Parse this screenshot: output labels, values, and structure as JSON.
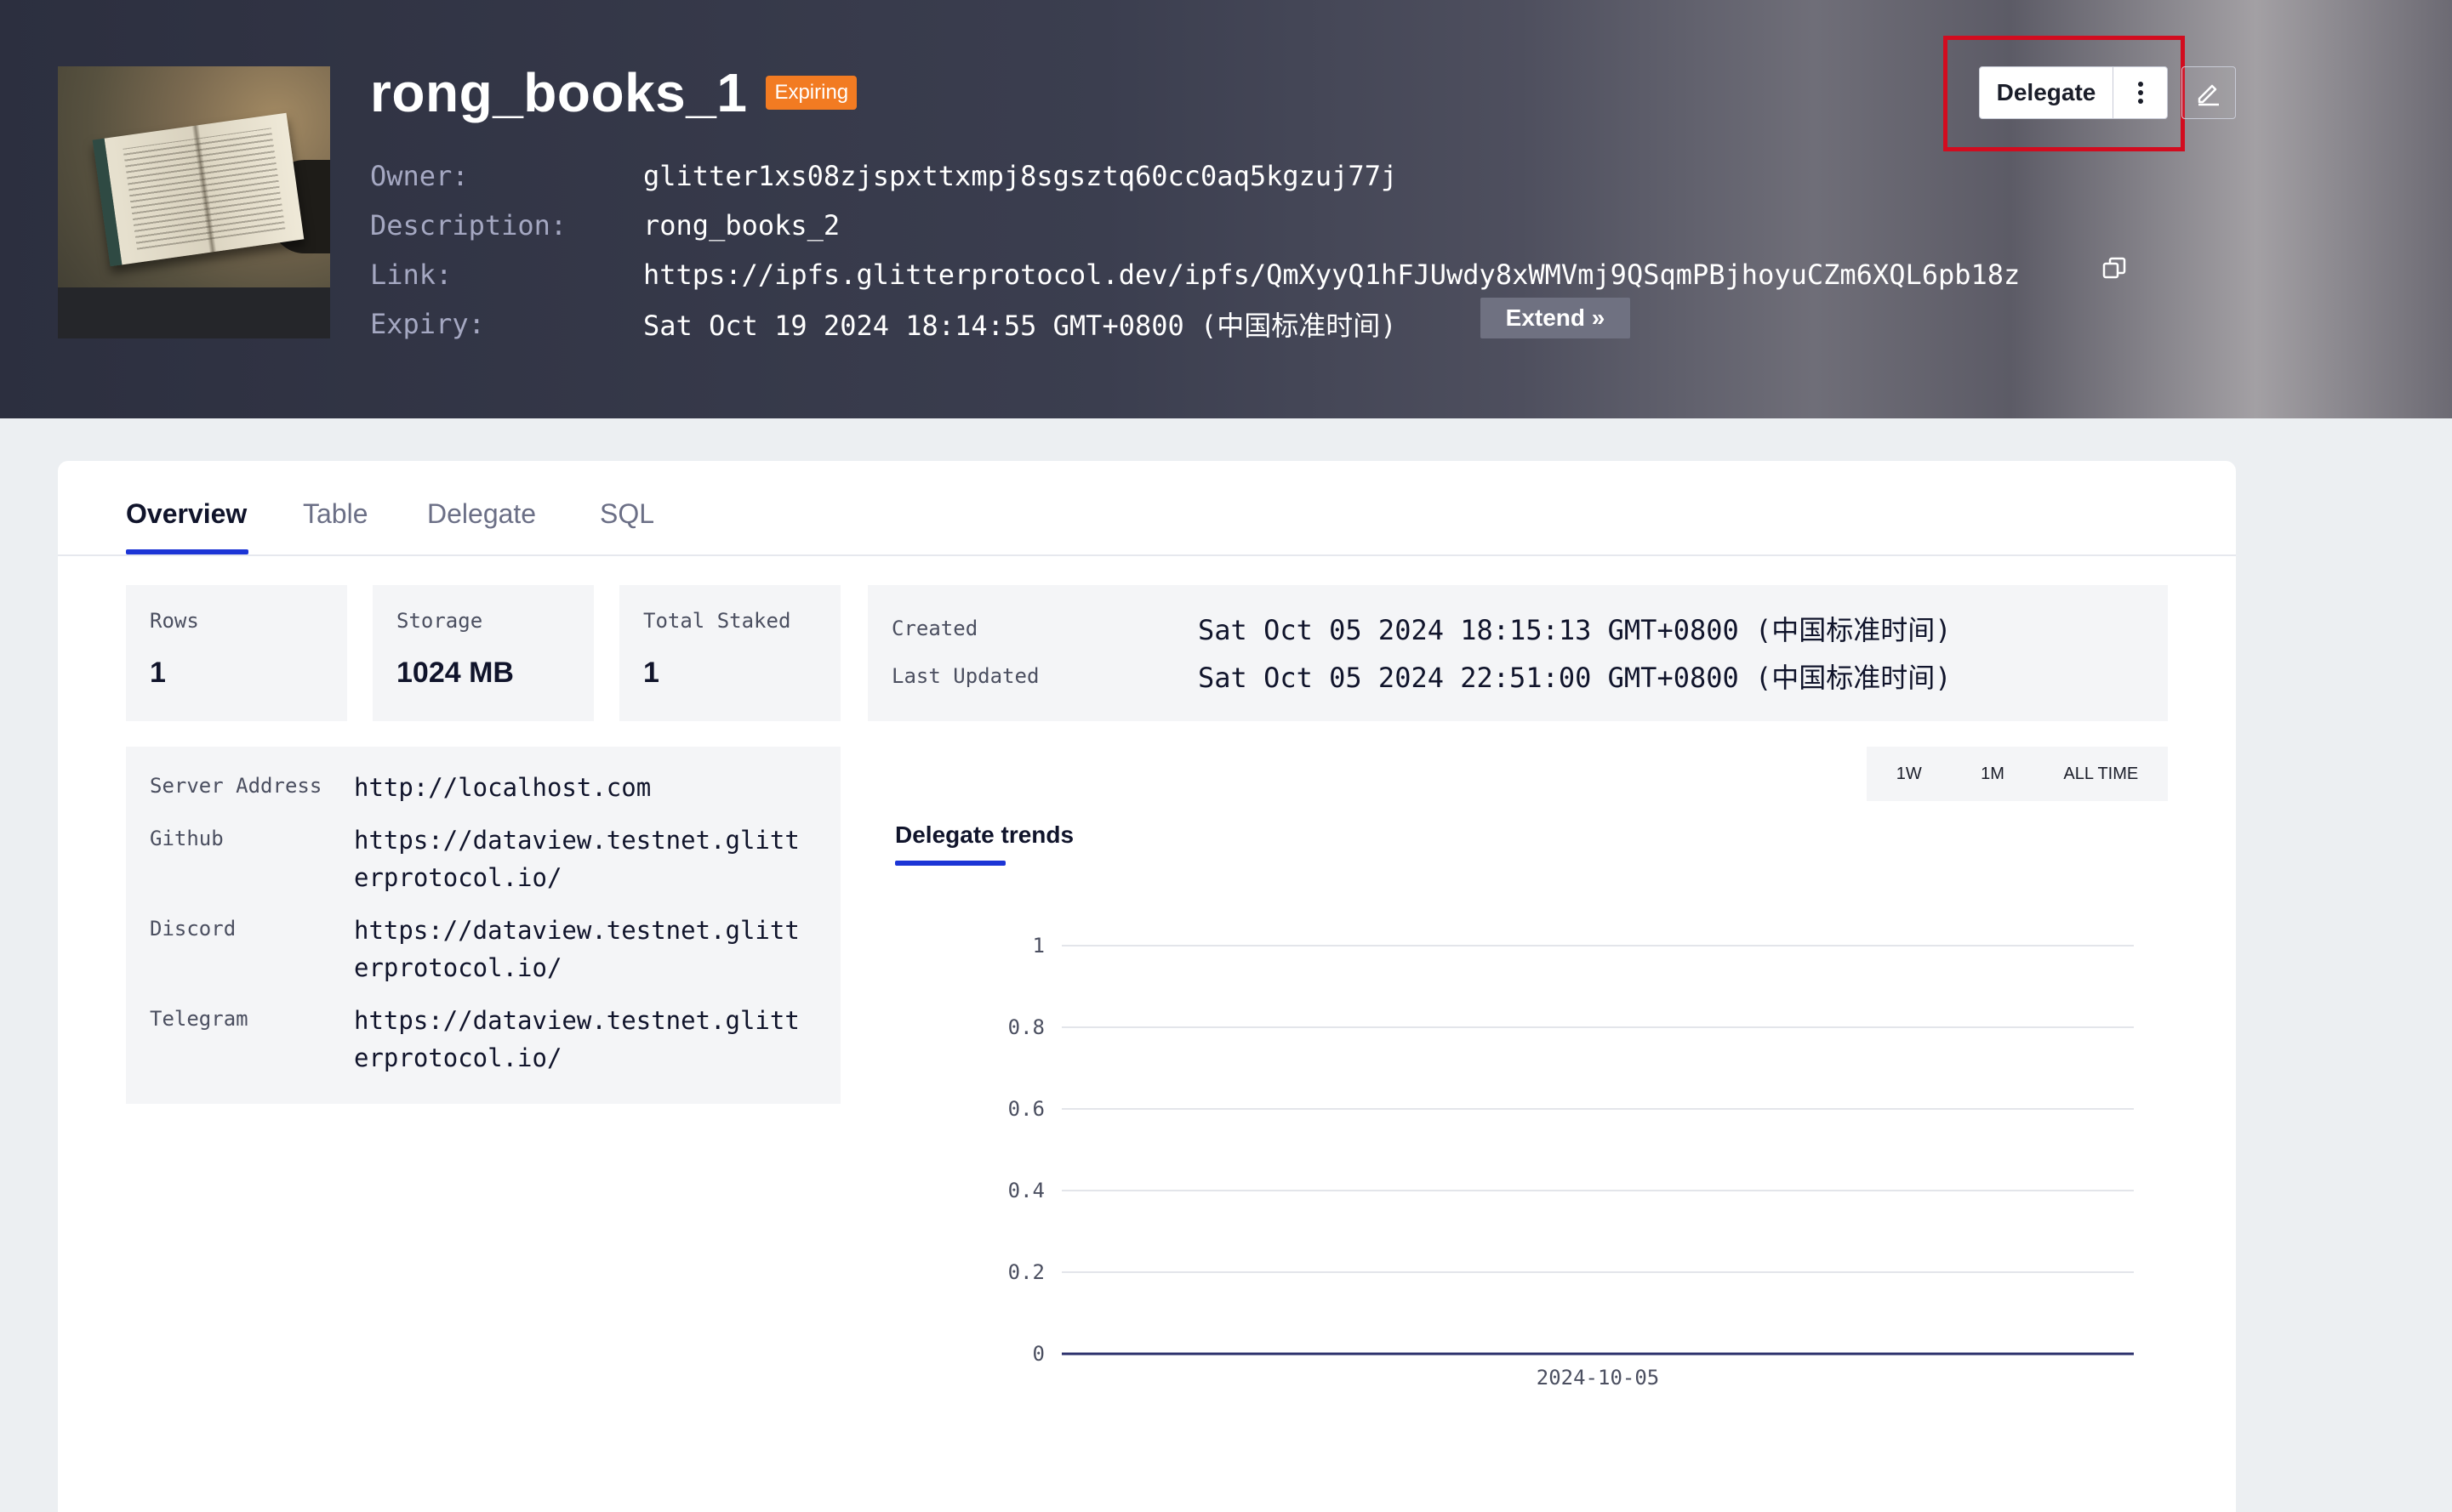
{
  "header": {
    "title": "rong_books_1",
    "badge": "Expiring",
    "owner_label": "Owner:",
    "owner": "glitter1xs08zjspxttxmpj8sgsztq60cc0aq5kgzuj77j",
    "description_label": "Description:",
    "description": "rong_books_2",
    "link_label": "Link:",
    "link": "https://ipfs.glitterprotocol.dev/ipfs/QmXyyQ1hFJUwdy8xWMVmj9QSqmPBjhoyuCZm6XQL6pb18z",
    "expiry_label": "Expiry:",
    "expiry": "Sat Oct 19 2024 18:14:55 GMT+0800 (中国标准时间)",
    "extend_label": "Extend »",
    "delegate_label": "Delegate",
    "highlight_color": "#d20c1f",
    "badge_color": "#f27b22"
  },
  "tabs": [
    {
      "label": "Overview"
    },
    {
      "label": "Table"
    },
    {
      "label": "Delegate"
    },
    {
      "label": "SQL"
    }
  ],
  "stats": {
    "rows_label": "Rows",
    "rows": "1",
    "storage_label": "Storage",
    "storage": "1024 MB",
    "staked_label": "Total Staked",
    "staked": "1"
  },
  "dates": {
    "created_label": "Created",
    "created": "Sat Oct 05 2024 18:15:13 GMT+0800 (中国标准时间)",
    "updated_label": "Last Updated",
    "updated": "Sat Oct 05 2024 22:51:00 GMT+0800 (中国标准时间)"
  },
  "links": [
    {
      "label": "Server Address",
      "value": "http://localhost.com"
    },
    {
      "label": "Github",
      "value": "https://dataview.testnet.glitterprotocol.io/"
    },
    {
      "label": "Discord",
      "value": "https://dataview.testnet.glitterprotocol.io/"
    },
    {
      "label": "Telegram",
      "value": "https://dataview.testnet.glitterprotocol.io/"
    }
  ],
  "range": {
    "w": "1W",
    "m": "1M",
    "all": "ALL TIME"
  },
  "trend_title": "Delegate trends",
  "accent_color": "#1c35d6",
  "chart_data": {
    "type": "line",
    "x": [
      "2024-10-05"
    ],
    "series": [
      {
        "values": [
          0
        ]
      }
    ],
    "ylim": [
      0,
      1
    ],
    "yticks": [
      "0",
      "0.2",
      "0.4",
      "0.6",
      "0.8",
      "1"
    ],
    "grid": true
  }
}
